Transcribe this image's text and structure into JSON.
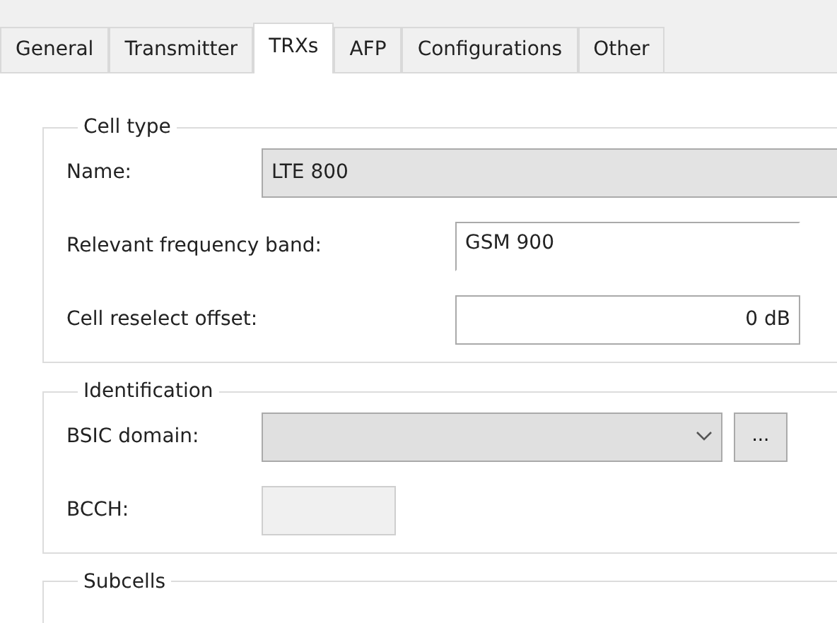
{
  "tabs": [
    {
      "label": "General",
      "selected": false
    },
    {
      "label": "Transmitter",
      "selected": false
    },
    {
      "label": "TRXs",
      "selected": true
    },
    {
      "label": "AFP",
      "selected": false
    },
    {
      "label": "Configurations",
      "selected": false
    },
    {
      "label": "Other",
      "selected": false
    }
  ],
  "groups": [
    {
      "legend": "Cell type",
      "fields": [
        {
          "kind": "readonly",
          "label": "Name:",
          "value": "LTE 800"
        },
        {
          "kind": "combo",
          "label": "Relevant frequency band:",
          "value": "GSM 900"
        },
        {
          "kind": "number",
          "label": "Cell reselect offset:",
          "value": "0 dB"
        }
      ]
    },
    {
      "legend": "Identification",
      "fields": [
        {
          "kind": "dropdown",
          "label": "BSIC domain:",
          "button": "..."
        },
        {
          "kind": "disabled",
          "label": "BCCH:"
        }
      ]
    },
    {
      "legend": "Subcells"
    }
  ]
}
